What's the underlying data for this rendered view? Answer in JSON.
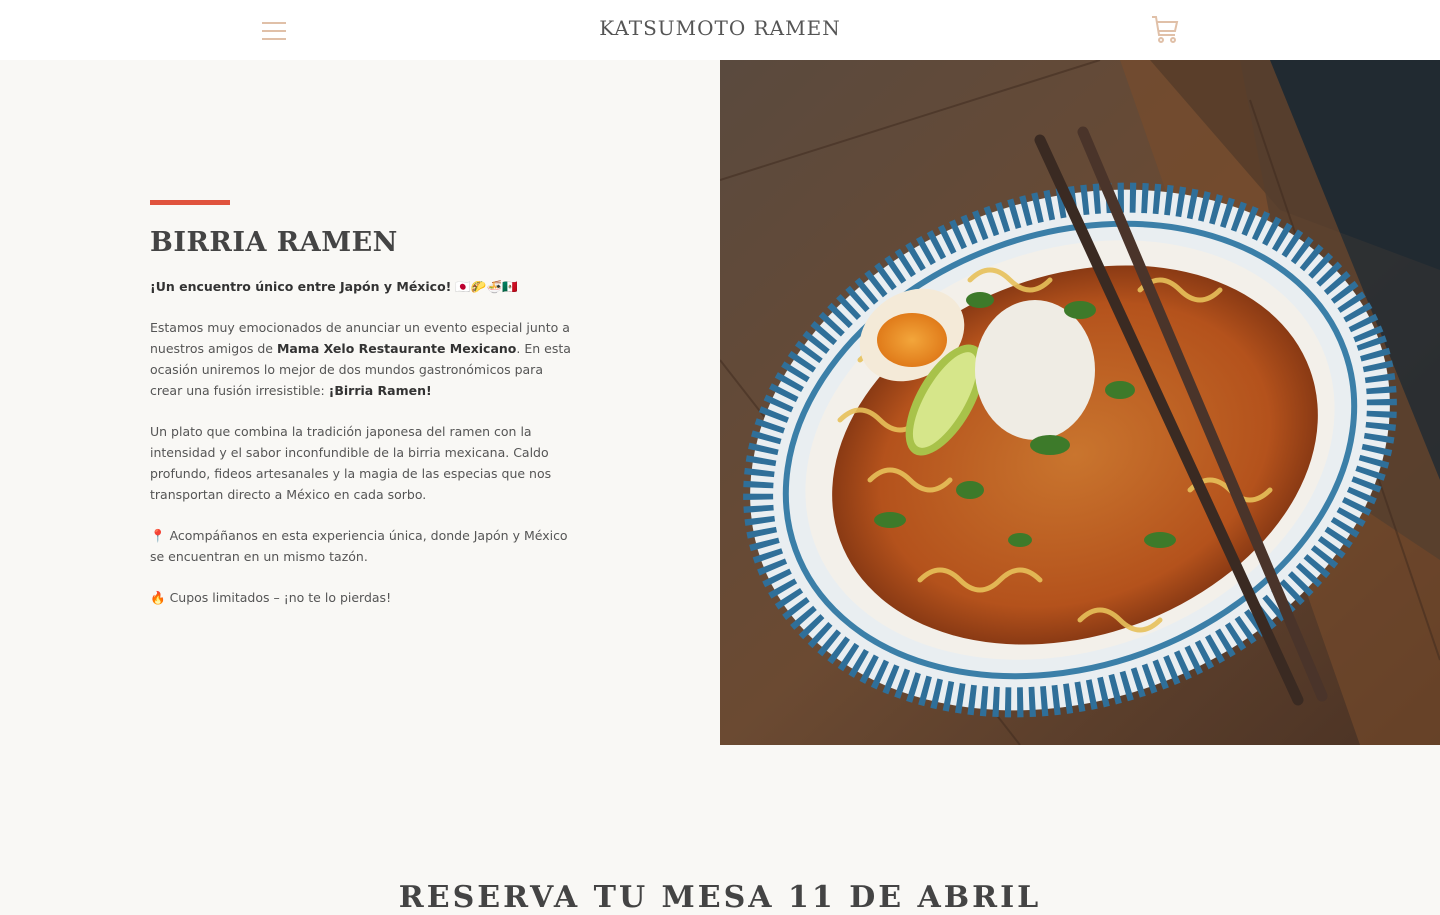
{
  "header": {
    "logo": "KATSUMOTO RAMEN",
    "menu_icon": "hamburger-menu-icon",
    "cart_icon": "shopping-cart-icon",
    "icon_color": "#e0c0a8"
  },
  "feature": {
    "accent_color": "#e0533d",
    "title": "BIRRIA RAMEN",
    "intro": "¡Un encuentro único entre Japón y México!",
    "intro_emojis": "🇯🇵🌮🍜🇲🇽",
    "p2_start": "Estamos muy emocionados de anunciar un evento especial junto a nuestros amigos de ",
    "p2_bold": "Mama Xelo Restaurante Mexicano",
    "p2_mid": ". En esta ocasión uniremos lo mejor de dos mundos gastronómicos para crear una fusión irresistible: ",
    "p2_bold2": "¡Birria Ramen!",
    "p3": "Un plato que combina la tradición japonesa del ramen con la intensidad y el sabor inconfundible de la birria mexicana. Caldo profundo, fideos artesanales y la magia de las especias que nos transportan directo a México en cada sorbo.",
    "p4_icon": "📍",
    "p4": "Acompáñanos en esta experiencia única, donde Japón y México se encuentran en un mismo tazón.",
    "p5_icon": "🔥",
    "p5": "Cupos limitados – ¡no te lo pierdas!",
    "image_alt": "birria-ramen-bowl-photo"
  },
  "reserve": {
    "heading": "RESERVA TU MESA 11 DE ABRIL"
  }
}
